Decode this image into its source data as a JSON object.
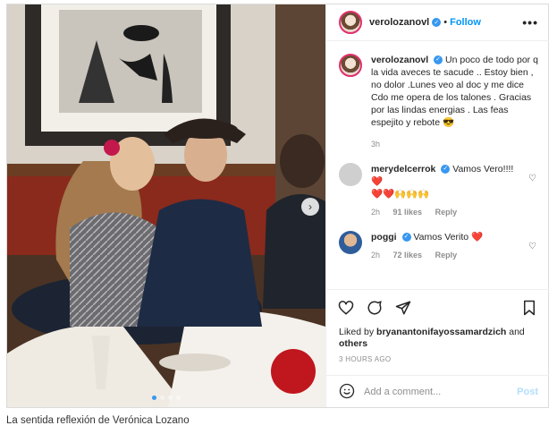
{
  "post": {
    "username": "verolozanovl",
    "follow_label": "Follow",
    "more_label": "•••",
    "caption_username": "verolozanovl",
    "caption_text": "Un poco de todo por q la vida aveces te sacude .. Estoy bien , no dolor .Lunes veo al doc y me dice Cdo me opera de los talones . Gracias por las lindas energias . Las feas espejito y rebote 😎",
    "caption_time": "3h",
    "comments": [
      {
        "username": "merydelcerrok",
        "text": "Vamos Vero!!!! ❤️",
        "extra": "❤️❤️🙌🙌🙌",
        "time": "2h",
        "likes": "91 likes",
        "reply": "Reply"
      },
      {
        "username": "poggi",
        "text": "Vamos Verito ❤️",
        "time": "2h",
        "likes": "72 likes",
        "reply": "Reply"
      }
    ],
    "liked_by_prefix": "Liked by",
    "liked_by_user": "bryanantonifayossamardzich",
    "liked_by_and": "and",
    "liked_by_others": "others",
    "timestamp": "3 HOURS AGO",
    "add_comment_placeholder": "Add a comment...",
    "post_label": "Post"
  },
  "page_caption": "La sentida reflexión de Verónica Lozano",
  "icons": {
    "heart": "heart-icon",
    "comment": "comment-icon",
    "share": "share-icon",
    "save": "bookmark-icon",
    "emoji": "emoji-icon",
    "next": "chevron-right-icon"
  },
  "colors": {
    "accent": "#0095f6",
    "verified": "#3897f0",
    "heart": "#ed4956"
  }
}
